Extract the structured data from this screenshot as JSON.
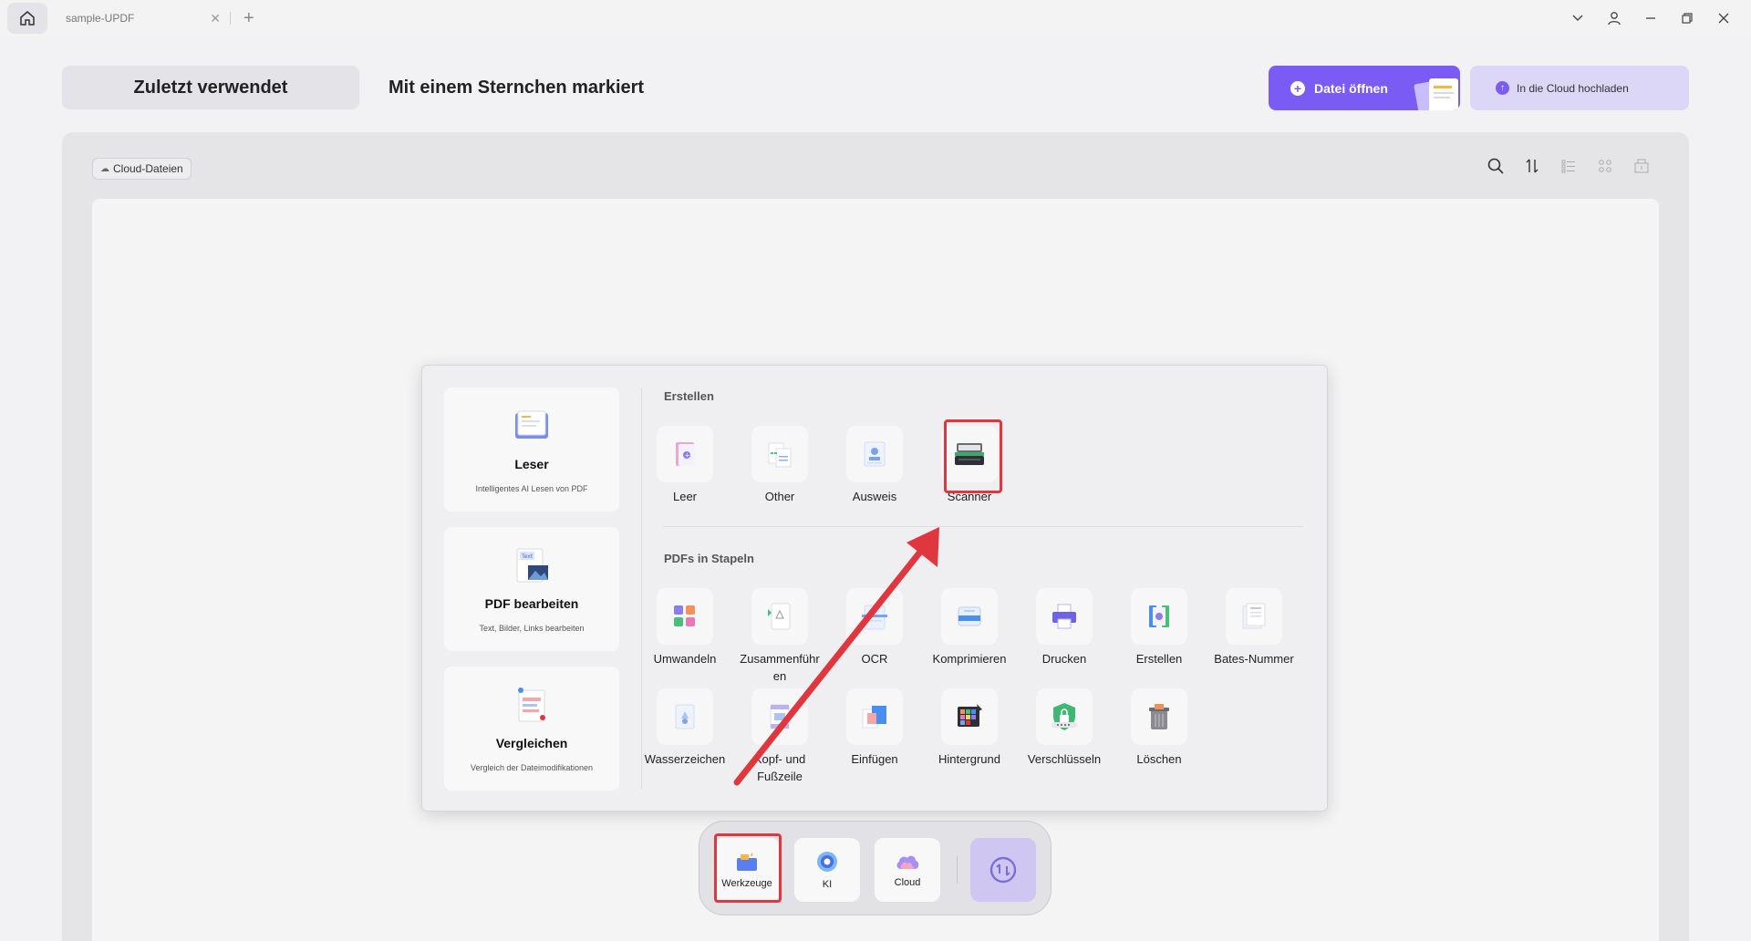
{
  "titlebar": {
    "tab_label": "sample-UPDF",
    "tab_close": "✕",
    "tab_add": "+"
  },
  "nav": {
    "recent": "Zuletzt verwendet",
    "starred": "Mit einem Sternchen markiert",
    "open_file": "Datei öffnen",
    "cloud_upload": "In die Cloud hochladen"
  },
  "filter": {
    "cloud_files": "Cloud-Dateien"
  },
  "popup": {
    "features": [
      {
        "title": "Leser",
        "subtitle": "Intelligentes AI Lesen von PDF"
      },
      {
        "title": "PDF bearbeiten",
        "subtitle": "Text, Bilder, Links bearbeiten"
      },
      {
        "title": "Vergleichen",
        "subtitle": "Vergleich der Dateimodifikationen"
      }
    ],
    "create_section": "Erstellen",
    "create_tools": [
      "Leer",
      "Other",
      "Ausweis",
      "Scanner"
    ],
    "batch_section": "PDFs in Stapeln",
    "batch_tools_row1": [
      "Umwandeln",
      "Zusammenführen",
      "OCR",
      "Komprimieren",
      "Drucken",
      "Erstellen",
      "Bates-Nummer"
    ],
    "batch_tools_row2": [
      "Wasserzeichen",
      "Kopf- und Fußzeile",
      "Einfügen",
      "Hintergrund",
      "Verschlüsseln",
      "Löschen"
    ]
  },
  "dock": {
    "tools": "Werkzeuge",
    "ai": "KI",
    "cloud": "Cloud"
  },
  "colors": {
    "accent": "#7a5cf5",
    "highlight": "#e0373f"
  }
}
